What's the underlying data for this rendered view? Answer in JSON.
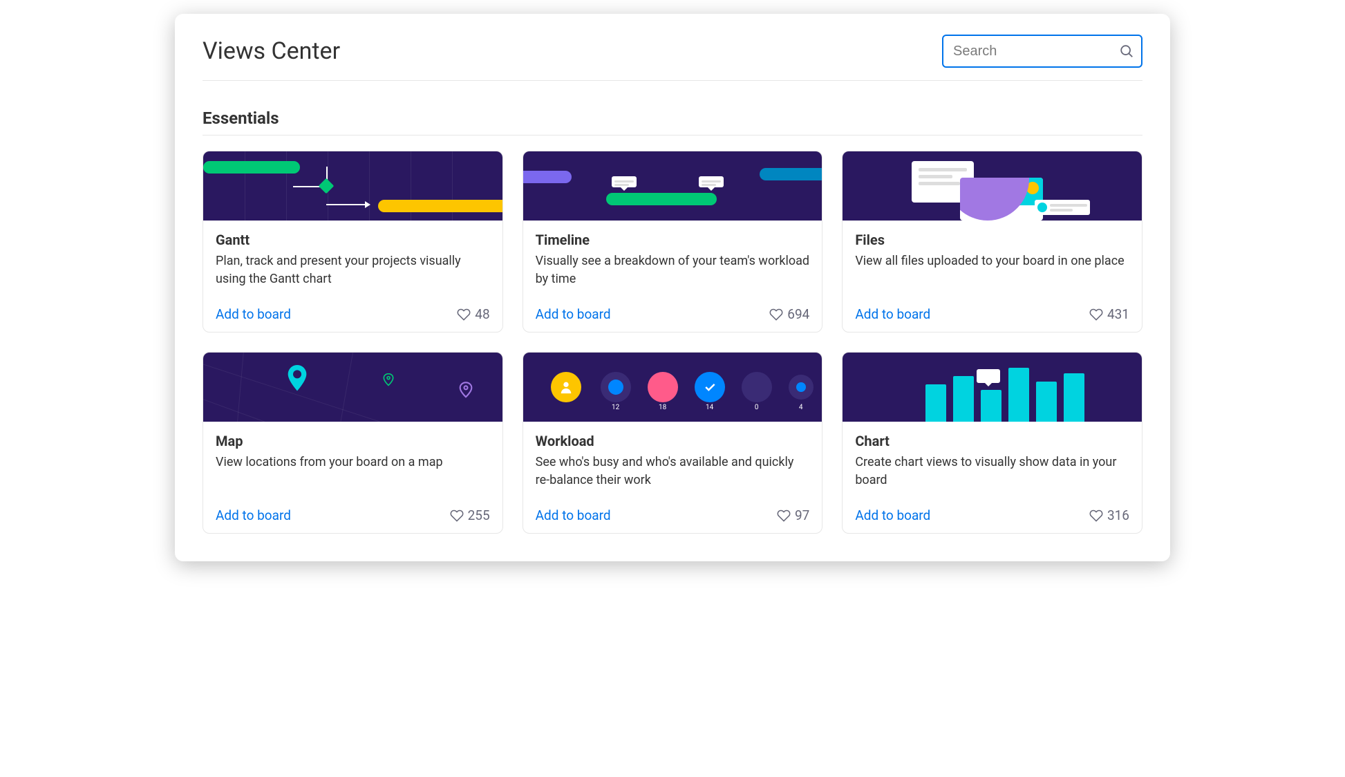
{
  "header": {
    "title": "Views Center",
    "search_placeholder": "Search"
  },
  "section_title": "Essentials",
  "add_label": "Add to board",
  "cards": [
    {
      "title": "Gantt",
      "desc": "Plan, track and present your projects visually using the Gantt chart",
      "likes": "48"
    },
    {
      "title": "Timeline",
      "desc": "Visually see a breakdown of your team's workload by time",
      "likes": "694"
    },
    {
      "title": "Files",
      "desc": "View all files uploaded to your board in one place",
      "likes": "431"
    },
    {
      "title": "Map",
      "desc": "View locations from your board on a map",
      "likes": "255"
    },
    {
      "title": "Workload",
      "desc": "See who's busy and who's available and quickly re-balance their work",
      "likes": "97"
    },
    {
      "title": "Chart",
      "desc": "Create chart views to visually show data in your board",
      "likes": "316"
    }
  ],
  "workload_numbers": [
    "12",
    "18",
    "14",
    "0",
    "4"
  ]
}
